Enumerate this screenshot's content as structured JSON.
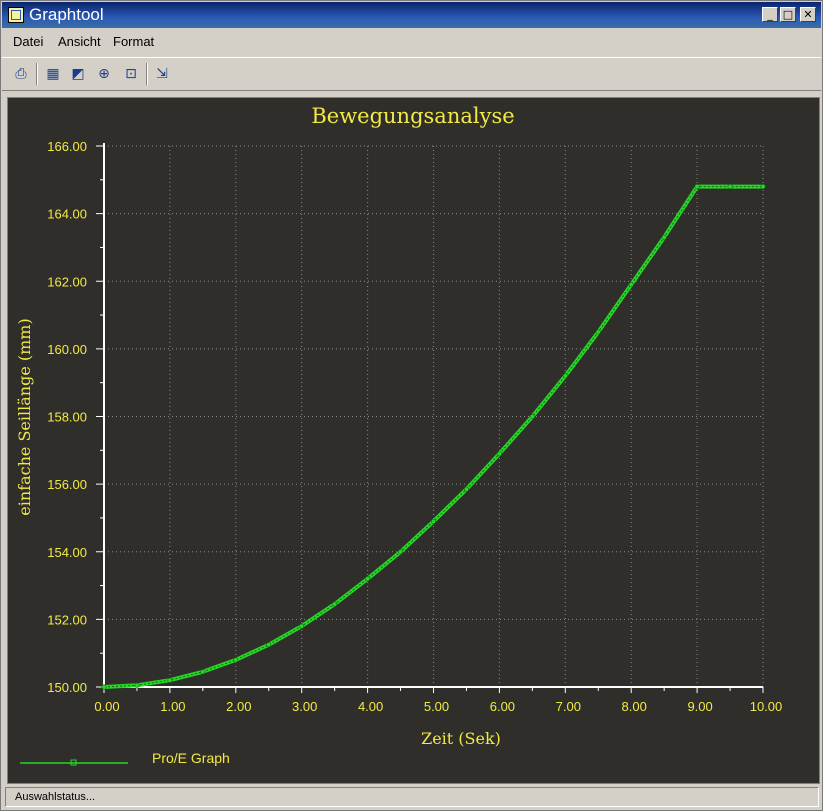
{
  "window": {
    "title": "Graphtool"
  },
  "titlebar": {
    "minimize": "_",
    "maximize": "□",
    "close": "✕"
  },
  "menu": {
    "items": [
      "Datei",
      "Ansicht",
      "Format"
    ]
  },
  "toolbar": {
    "icons": [
      "print-icon",
      "grid-icon",
      "edit-icon",
      "zoom-in-icon",
      "zoom-fit-icon",
      "export-icon"
    ]
  },
  "colors": {
    "background": "#2f2e2b",
    "text": "#f2ea44",
    "grid": "#8a8a8a",
    "axis": "#ffffff",
    "series": "#27d627"
  },
  "chart_data": {
    "type": "line",
    "title": "Bewegungsanalyse",
    "xlabel": "Zeit (Sek)",
    "ylabel": "einfache Seillänge (mm)",
    "xlim": [
      0,
      10
    ],
    "ylim": [
      150,
      166
    ],
    "x_ticks": [
      "0.00",
      "1.00",
      "2.00",
      "3.00",
      "4.00",
      "5.00",
      "6.00",
      "7.00",
      "8.00",
      "9.00",
      "10.00"
    ],
    "y_ticks": [
      "150.00",
      "152.00",
      "154.00",
      "156.00",
      "158.00",
      "160.00",
      "162.00",
      "164.00",
      "166.00"
    ],
    "grid": true,
    "legend": "bottom-left",
    "series": [
      {
        "name": "Pro/E Graph",
        "x": [
          0,
          0.5,
          1,
          1.5,
          2,
          2.5,
          3,
          3.5,
          4,
          4.5,
          5,
          5.5,
          6,
          6.5,
          7,
          7.5,
          8,
          8.5,
          9,
          9.5,
          10
        ],
        "y": [
          150.0,
          150.05,
          150.2,
          150.45,
          150.8,
          151.25,
          151.8,
          152.45,
          153.2,
          154.0,
          154.9,
          155.85,
          156.9,
          158.0,
          159.2,
          160.5,
          161.9,
          163.3,
          164.8,
          164.8,
          164.8
        ]
      }
    ]
  },
  "status": {
    "text": "Auswahlstatus..."
  }
}
